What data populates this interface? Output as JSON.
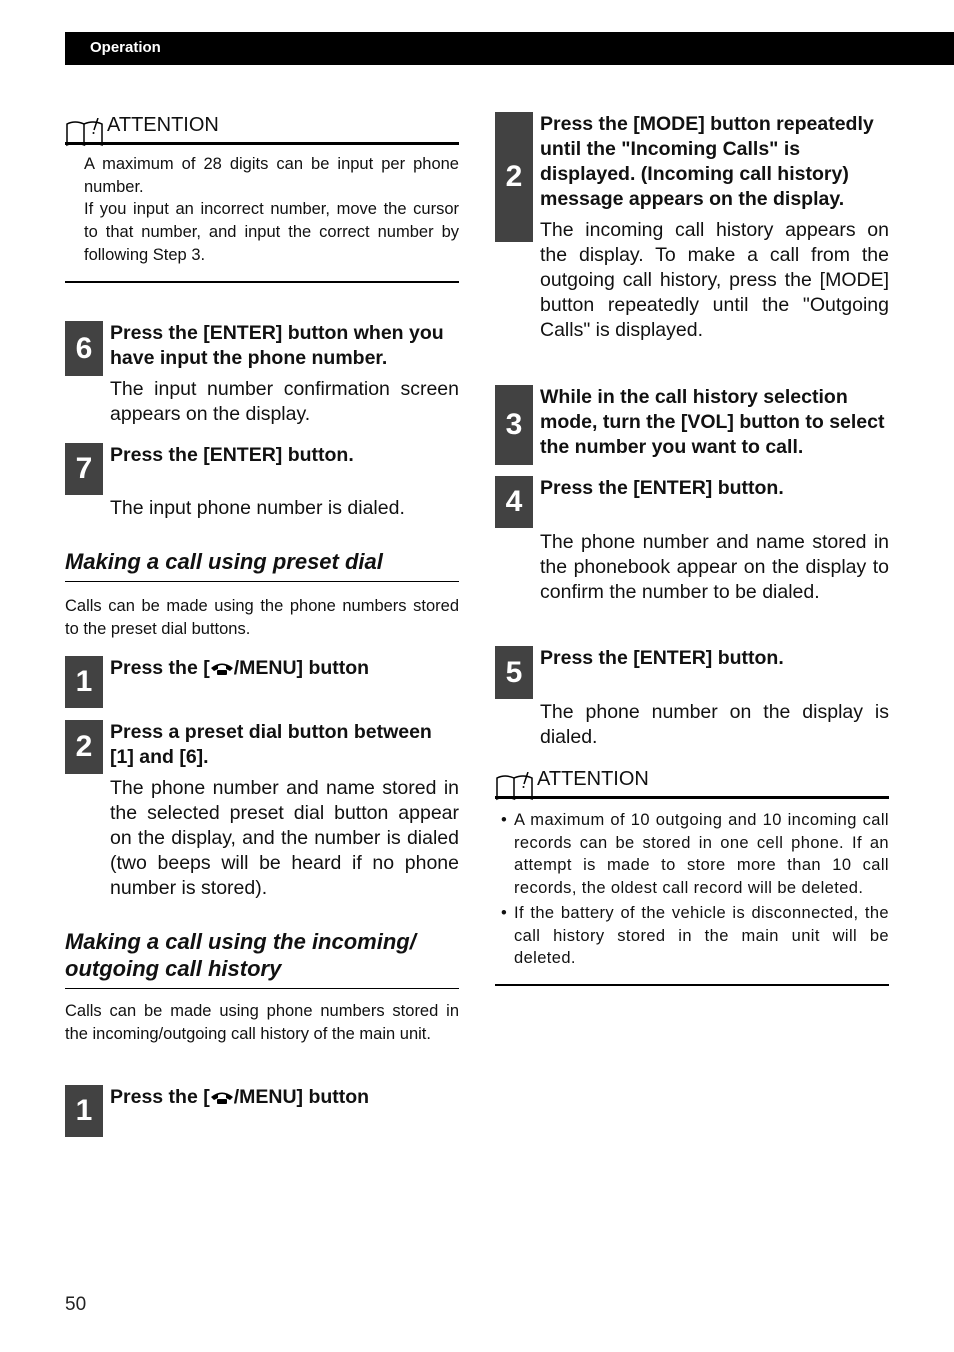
{
  "header": {
    "section": "Operation"
  },
  "left": {
    "attention1": {
      "title": "ATTENTION",
      "lines": [
        "A maximum of 28 digits can be input per phone number.",
        "If you input an incorrect number, move the cursor to that number, and input the correct number by following Step 3."
      ]
    },
    "step6": {
      "num": "6",
      "title": "Press the [ENTER] button when you have input the phone number.",
      "desc": "The input number confirmation screen appears on the display."
    },
    "step7": {
      "num": "7",
      "title": "Press the [ENTER] button.",
      "desc": "The input phone number is dialed."
    },
    "preset": {
      "title": "Making a call using preset dial",
      "intro": "Calls can be made using the phone numbers stored to the preset dial buttons.",
      "step1": {
        "num": "1",
        "title_pre": "Press the [",
        "icon": "phone-handset-icon",
        "title_post": "/MENU] button"
      },
      "step2": {
        "num": "2",
        "title": "Press a preset dial button between [1] and [6].",
        "desc": "The phone number and name stored in the selected preset dial button appear on the display, and the number is dialed (two beeps will be heard if no phone number is stored)."
      }
    },
    "history": {
      "title": "Making a call using the incoming/ outgoing call history",
      "intro": "Calls can be made using phone numbers stored in the incoming/outgoing call history of the main unit.",
      "step1": {
        "num": "1",
        "title_pre": "Press the [",
        "icon": "phone-handset-icon",
        "title_post": "/MENU] button"
      }
    }
  },
  "right": {
    "step2": {
      "num": "2",
      "title": "Press the [MODE] button repeatedly until the \"Incoming Calls\" is displayed. (Incoming call history) message appears on the display.",
      "desc": "The incoming call history appears on the display. To make a call from the outgoing call history, press the [MODE] button repeatedly until the \"Outgoing Calls\" is displayed."
    },
    "step3": {
      "num": "3",
      "title": "While in the call history selection mode, turn the [VOL] button to select the number you want to call."
    },
    "step4": {
      "num": "4",
      "title": "Press the [ENTER] button.",
      "desc": "The phone number and name stored in the phonebook appear on the display to confirm the number to be dialed."
    },
    "step5": {
      "num": "5",
      "title": "Press the [ENTER] button.",
      "desc": "The phone number on the display is dialed."
    },
    "attention2": {
      "title": "ATTENTION",
      "items": [
        "A maximum of 10 outgoing and 10 incoming call records can be stored in one cell phone. If an attempt is made to store more than 10 call records, the oldest call record will be deleted.",
        "If the battery of the vehicle is disconnected, the call history stored in the main unit will be deleted."
      ]
    }
  },
  "footer": {
    "page_number": "50"
  }
}
